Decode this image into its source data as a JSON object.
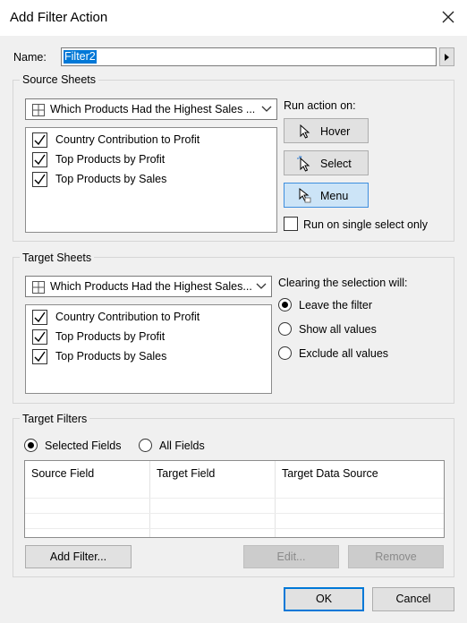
{
  "window": {
    "title": "Add Filter Action"
  },
  "name": {
    "label": "Name:",
    "value": "Filter2"
  },
  "source_sheets": {
    "title": "Source Sheets",
    "selected_sheet": "Which Products Had the Highest Sales ...",
    "items": [
      "Country Contribution to Profit",
      "Top Products by Profit",
      "Top Products by Sales"
    ],
    "checked": [
      true,
      true,
      true
    ]
  },
  "run_action": {
    "label": "Run action on:",
    "hover": "Hover",
    "select": "Select",
    "menu": "Menu",
    "selected": "Menu",
    "single_select_label": "Run on single select only",
    "single_select_checked": false
  },
  "target_sheets": {
    "title": "Target Sheets",
    "selected_sheet": "Which Products Had the Highest Sales...",
    "items": [
      "Country Contribution to Profit",
      "Top Products by Profit",
      "Top Products by Sales"
    ],
    "checked": [
      true,
      true,
      true
    ]
  },
  "clearing": {
    "label": "Clearing the selection will:",
    "options": [
      "Leave the filter",
      "Show all values",
      "Exclude all values"
    ],
    "selected": "Leave the filter"
  },
  "target_filters": {
    "title": "Target Filters",
    "scope_options": [
      "Selected Fields",
      "All Fields"
    ],
    "scope_selected": "Selected Fields",
    "columns": [
      "Source Field",
      "Target Field",
      "Target Data Source"
    ],
    "add_filter": "Add Filter...",
    "edit": "Edit...",
    "remove": "Remove"
  },
  "footer": {
    "ok": "OK",
    "cancel": "Cancel"
  }
}
